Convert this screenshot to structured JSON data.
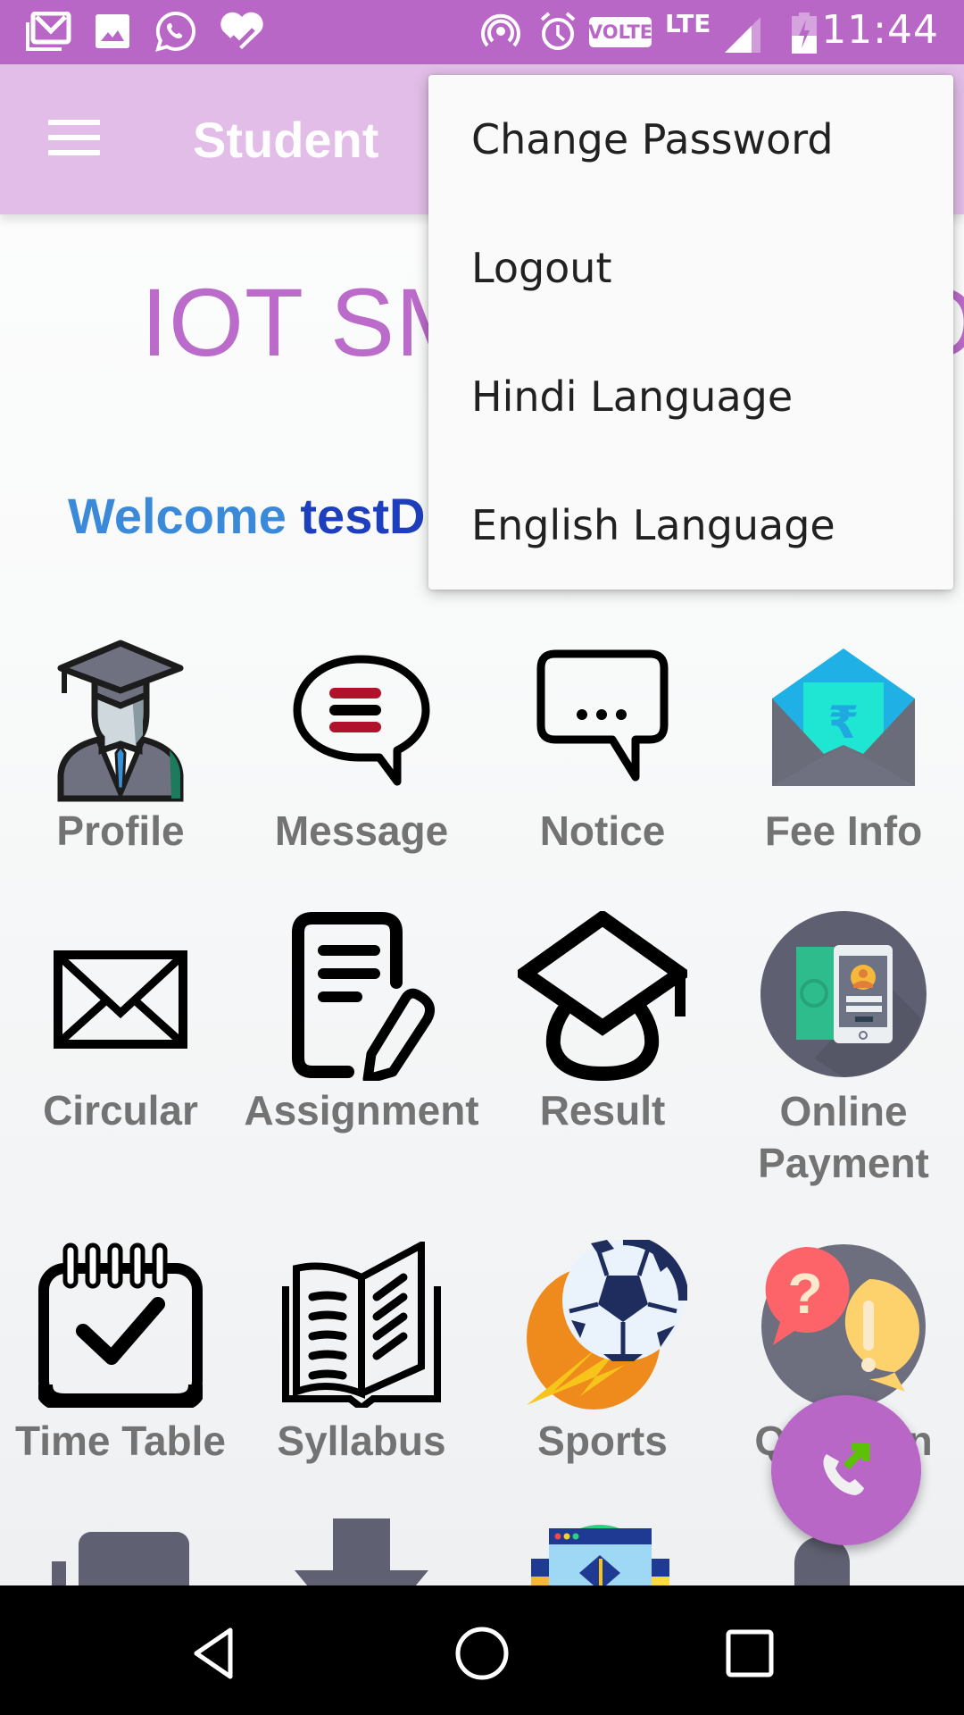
{
  "status_bar": {
    "time": "11:44",
    "volte": "VOLTE",
    "network": "LTE",
    "left_icons": [
      "gmail-icon",
      "gallery-icon",
      "whatsapp-icon",
      "health-heart-icon"
    ],
    "right_icons": [
      "hotspot-icon",
      "alarm-icon",
      "volte-badge",
      "lte-label",
      "signal-icon",
      "battery-charging-icon"
    ]
  },
  "app_bar": {
    "menu_icon": "hamburger-icon",
    "title": "Student"
  },
  "main": {
    "brand_title": "IOT SMART SCHOOL",
    "welcome_prefix": "Welcome",
    "welcome_user": "testD"
  },
  "overflow_menu": {
    "items": [
      {
        "label": "Change Password"
      },
      {
        "label": "Logout"
      },
      {
        "label": "Hindi Language"
      },
      {
        "label": "English Language"
      }
    ]
  },
  "grid": {
    "tiles": [
      {
        "label": "Profile",
        "icon": "graduate-profile-icon"
      },
      {
        "label": "Message",
        "icon": "message-bubble-icon"
      },
      {
        "label": "Notice",
        "icon": "notice-bubble-icon"
      },
      {
        "label": "Fee Info",
        "icon": "fee-envelope-icon"
      },
      {
        "label": "Circular",
        "icon": "envelope-icon"
      },
      {
        "label": "Assignment",
        "icon": "assignment-icon"
      },
      {
        "label": "Result",
        "icon": "graduation-cap-icon"
      },
      {
        "label": "Online Payment",
        "icon": "online-payment-icon"
      },
      {
        "label": "Time Table",
        "icon": "calendar-check-icon"
      },
      {
        "label": "Syllabus",
        "icon": "open-book-icon"
      },
      {
        "label": "Sports",
        "icon": "football-icon"
      },
      {
        "label": "Question",
        "icon": "question-bubbles-icon"
      }
    ]
  },
  "fab": {
    "icon": "call-outgoing-icon"
  },
  "nav_bar": {
    "buttons": [
      "back-icon",
      "home-icon",
      "recents-icon"
    ]
  },
  "colors": {
    "status_bar": "#b967c7",
    "app_bar": "#e1bde7",
    "brand": "#bb6bc9",
    "welcome_prefix": "#3a8ad9",
    "welcome_user": "#1d3fbd",
    "tile_label": "#737373"
  }
}
